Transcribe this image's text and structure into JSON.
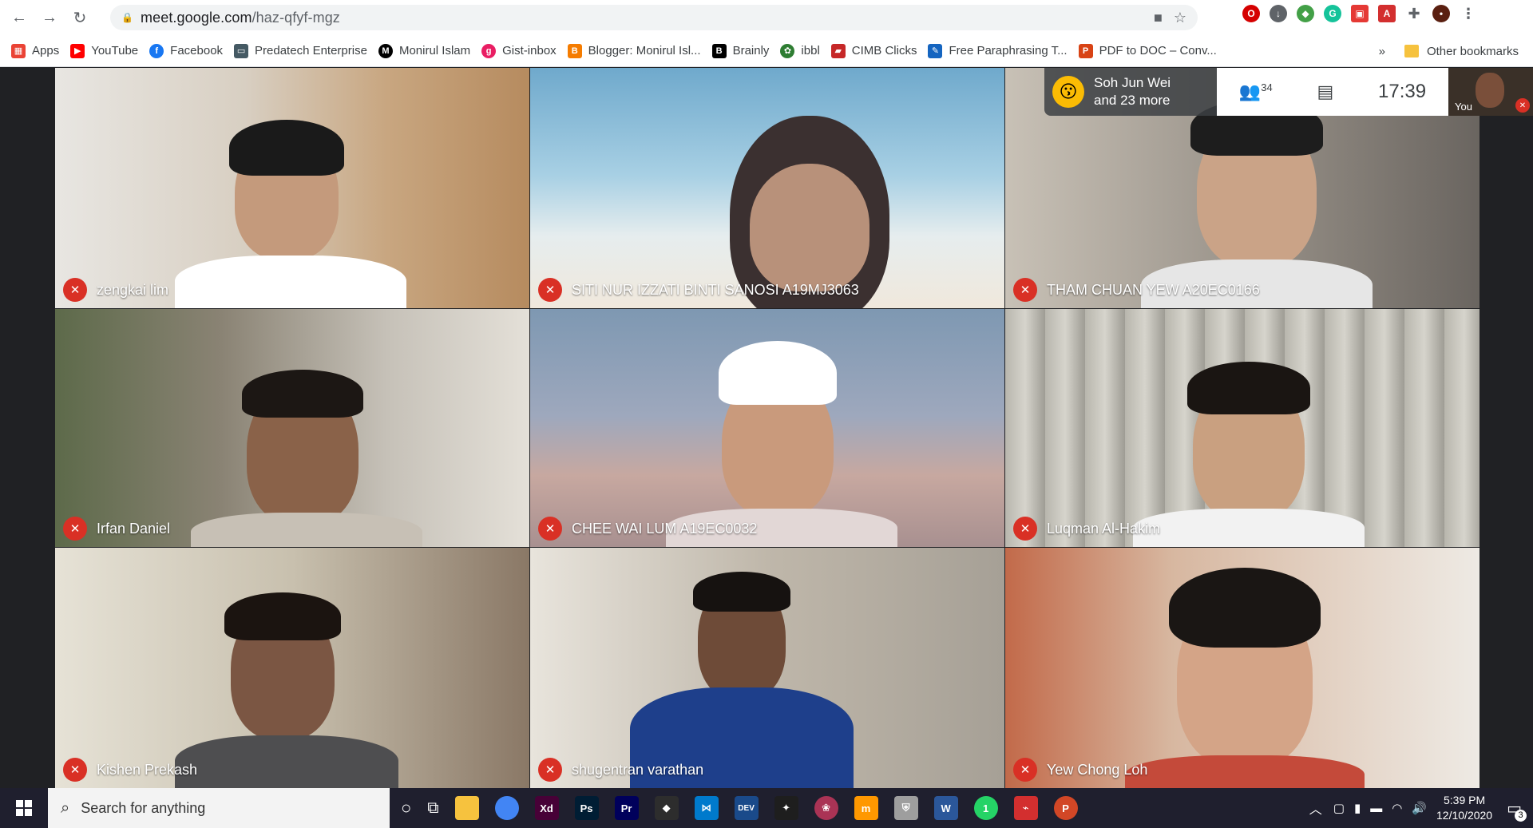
{
  "browser": {
    "url_host": "meet.google.com",
    "url_path": "/haz-qfyf-mgz"
  },
  "bookmarks": {
    "items": [
      {
        "label": "Apps",
        "icon": "apps-grid-icon",
        "color": "#ea4335"
      },
      {
        "label": "YouTube",
        "icon": "youtube-icon",
        "color": "#ff0000"
      },
      {
        "label": "Facebook",
        "icon": "facebook-icon",
        "color": "#1877f2"
      },
      {
        "label": "Predatech Enterprise",
        "icon": "monitor-icon",
        "color": "#455a64"
      },
      {
        "label": "Monirul Islam",
        "icon": "m-icon",
        "color": "#000000"
      },
      {
        "label": "Gist-inbox",
        "icon": "gist-icon",
        "color": "#e91e63"
      },
      {
        "label": "Blogger: Monirul Isl...",
        "icon": "blogger-icon",
        "color": "#f57c00"
      },
      {
        "label": "Brainly",
        "icon": "brainly-icon",
        "color": "#000000"
      },
      {
        "label": "ibbl",
        "icon": "ibbl-icon",
        "color": "#2e7d32"
      },
      {
        "label": "CIMB Clicks",
        "icon": "cimb-icon",
        "color": "#c62828"
      },
      {
        "label": "Free Paraphrasing T...",
        "icon": "quill-icon",
        "color": "#1565c0"
      },
      {
        "label": "PDF to DOC – Conv...",
        "icon": "pdf-icon",
        "color": "#d84315"
      }
    ],
    "overflow": "»",
    "other": "Other bookmarks"
  },
  "meet": {
    "speaker_text_1": "Soh Jun Wei",
    "speaker_text_2": "and 23 more",
    "participant_count": "34",
    "clock": "17:39",
    "you_label": "You",
    "tiles": [
      {
        "name": "zengkai lim",
        "bg": "#c9b9a0",
        "skin": "#c49a7c",
        "shirt": "#ffffff"
      },
      {
        "name": "SITI NUR IZZATI BINTI SANOSI A19MJ3063",
        "bg": "#8dbcd4",
        "skin": "#b8917a",
        "shirt": "#3b3030"
      },
      {
        "name": "THAM CHUAN YEW A20EC0166",
        "bg": "#a8a19a",
        "skin": "#caa387",
        "shirt": "#e6e6e6"
      },
      {
        "name": "Irfan Daniel",
        "bg": "#8a8374",
        "skin": "#8a6249",
        "shirt": "#c7c0b5"
      },
      {
        "name": "CHEE WAI LUM A19EC0032",
        "bg": "#9aa0b8",
        "skin": "#c99a7c",
        "shirt": "#e2d7d6"
      },
      {
        "name": "Luqman Al-Hakim",
        "bg": "#b8b6ad",
        "skin": "#c9a080",
        "shirt": "#f2f2f2"
      },
      {
        "name": "Kishen Prekash",
        "bg": "#c8c0ae",
        "skin": "#7b5643",
        "shirt": "#4e4e50"
      },
      {
        "name": "shugentran varathan",
        "bg": "#bfb7aa",
        "skin": "#6e4b38",
        "shirt": "#1e3f8b"
      },
      {
        "name": "Yew Chong Loh",
        "bg": "#d7b7a0",
        "skin": "#d4a487",
        "shirt": "#c44a3a"
      }
    ]
  },
  "taskbar": {
    "search_placeholder": "Search for anything",
    "time": "5:39 PM",
    "date": "12/10/2020",
    "notification_count": "3",
    "apps": [
      {
        "name": "file-explorer-icon",
        "label": "",
        "color": "#f6c23e"
      },
      {
        "name": "chrome-icon",
        "label": "",
        "color": "#4285f4"
      },
      {
        "name": "adobe-xd-icon",
        "label": "Xd",
        "color": "#470137"
      },
      {
        "name": "photoshop-icon",
        "label": "Ps",
        "color": "#001d34"
      },
      {
        "name": "premiere-icon",
        "label": "Pr",
        "color": "#00005b"
      },
      {
        "name": "kite-icon",
        "label": "",
        "color": "#2d2d2d"
      },
      {
        "name": "vscode-icon",
        "label": "",
        "color": "#007acc"
      },
      {
        "name": "devcpp-icon",
        "label": "DEV",
        "color": "#1a4a8a"
      },
      {
        "name": "figma-icon",
        "label": "",
        "color": "#1e1e1e"
      },
      {
        "name": "app-icon",
        "label": "",
        "color": "#aa3355"
      },
      {
        "name": "sublime-icon",
        "label": "m",
        "color": "#ff9800"
      },
      {
        "name": "security-icon",
        "label": "",
        "color": "#9e9e9e"
      },
      {
        "name": "word-icon",
        "label": "W",
        "color": "#2b579a"
      },
      {
        "name": "whatsapp-icon",
        "label": "1",
        "color": "#25d366"
      },
      {
        "name": "acrobat-icon",
        "label": "",
        "color": "#d32f2f"
      },
      {
        "name": "powerpoint-icon",
        "label": "P",
        "color": "#d24726"
      }
    ]
  }
}
